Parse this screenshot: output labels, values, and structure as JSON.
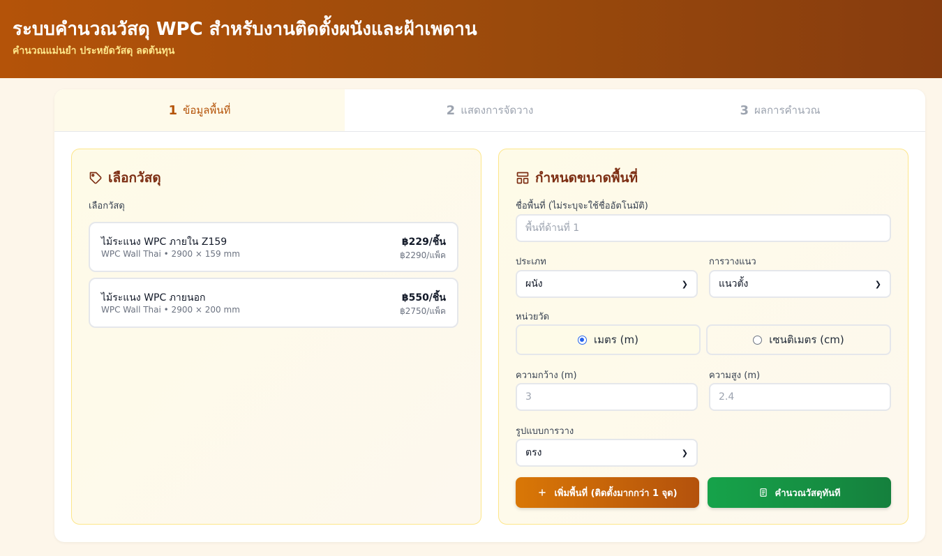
{
  "header": {
    "title": "ระบบคำนวณวัสดุ WPC สำหรับงานติดตั้งผนังและฝ้าเพดาน",
    "subtitle": "คำนวณแม่นยำ ประหยัดวัสดุ ลดต้นทุน"
  },
  "tabs": [
    {
      "num": "1",
      "label": "ข้อมูลพื้นที่",
      "active": true
    },
    {
      "num": "2",
      "label": "แสดงการจัดวาง",
      "active": false
    },
    {
      "num": "3",
      "label": "ผลการคำนวณ",
      "active": false
    }
  ],
  "materials": {
    "title": "เลือกวัสดุ",
    "label": "เลือกวัสดุ",
    "items": [
      {
        "name": "ไม้ระแนง WPC ภายใน Z159",
        "sub": "WPC Wall Thai • 2900 × 159 mm",
        "price": "฿229/ชิ้น",
        "pack": "฿2290/แพ็ค"
      },
      {
        "name": "ไม้ระแนง WPC ภายนอก",
        "sub": "WPC Wall Thai • 2900 × 200 mm",
        "price": "฿550/ชิ้น",
        "pack": "฿2750/แพ็ค"
      }
    ]
  },
  "area": {
    "title": "กำหนดขนาดพื้นที่",
    "name_label": "ชื่อพื้นที่ (ไม่ระบุจะใช้ชื่ออัตโนมัติ)",
    "name_placeholder": "พื้นที่ด้านที่ 1",
    "type_label": "ประเภท",
    "type_value": "ผนัง",
    "orientation_label": "การวางแนว",
    "orientation_value": "แนวตั้ง",
    "unit_label": "หน่วยวัด",
    "unit_options": [
      "เมตร (m)",
      "เซนติเมตร (cm)"
    ],
    "unit_selected": "เมตร (m)",
    "width_label": "ความกว้าง (m)",
    "width_placeholder": "3",
    "height_label": "ความสูง (m)",
    "height_placeholder": "2.4",
    "pattern_label": "รูปแบบการวาง",
    "pattern_value": "ตรง",
    "add_button": "เพิ่มพื้นที่ (ติดตั้งมากกว่า 1 จุด)",
    "calc_button": "คำนวณวัสดุทันที"
  },
  "colors": {
    "accent": "#b45309",
    "success": "#16a34a",
    "title_brown": "#7c2d12"
  }
}
